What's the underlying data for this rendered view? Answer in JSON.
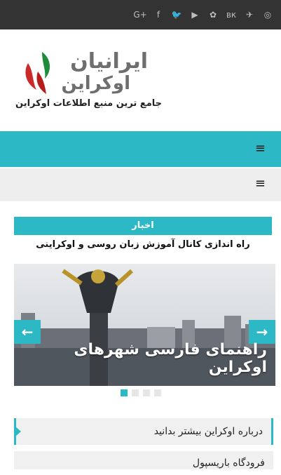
{
  "social": [
    {
      "label": "G+",
      "icon": "google-plus-icon"
    },
    {
      "label": "f",
      "icon": "facebook-icon"
    },
    {
      "label": "🐦",
      "icon": "twitter-icon"
    },
    {
      "label": "▶",
      "icon": "youtube-icon"
    },
    {
      "label": "✿",
      "icon": "dribbble-icon"
    },
    {
      "label": "вк",
      "icon": "vk-icon"
    },
    {
      "label": "✈",
      "icon": "telegram-icon"
    },
    {
      "label": "◎",
      "icon": "instagram-icon"
    }
  ],
  "brand": {
    "line1": "ایرانیان",
    "line2": "اوکراین",
    "tagline": "جامع ترین منبع اطلاعات اوکراین"
  },
  "nav": {
    "menu_icon": "≡"
  },
  "news": {
    "label": "اخبار",
    "headline": "راه اندازی کانال آموزش زبان روسی و اوکراینی"
  },
  "slider": {
    "caption": "راهنمای فارسی شهرهای اوکراین",
    "prev": "←",
    "next": "→",
    "dots": 4,
    "active": 0
  },
  "menu": {
    "item1": "درباره اوکراین بیشتر بدانید",
    "item2": "فرودگاه باریسپول"
  }
}
